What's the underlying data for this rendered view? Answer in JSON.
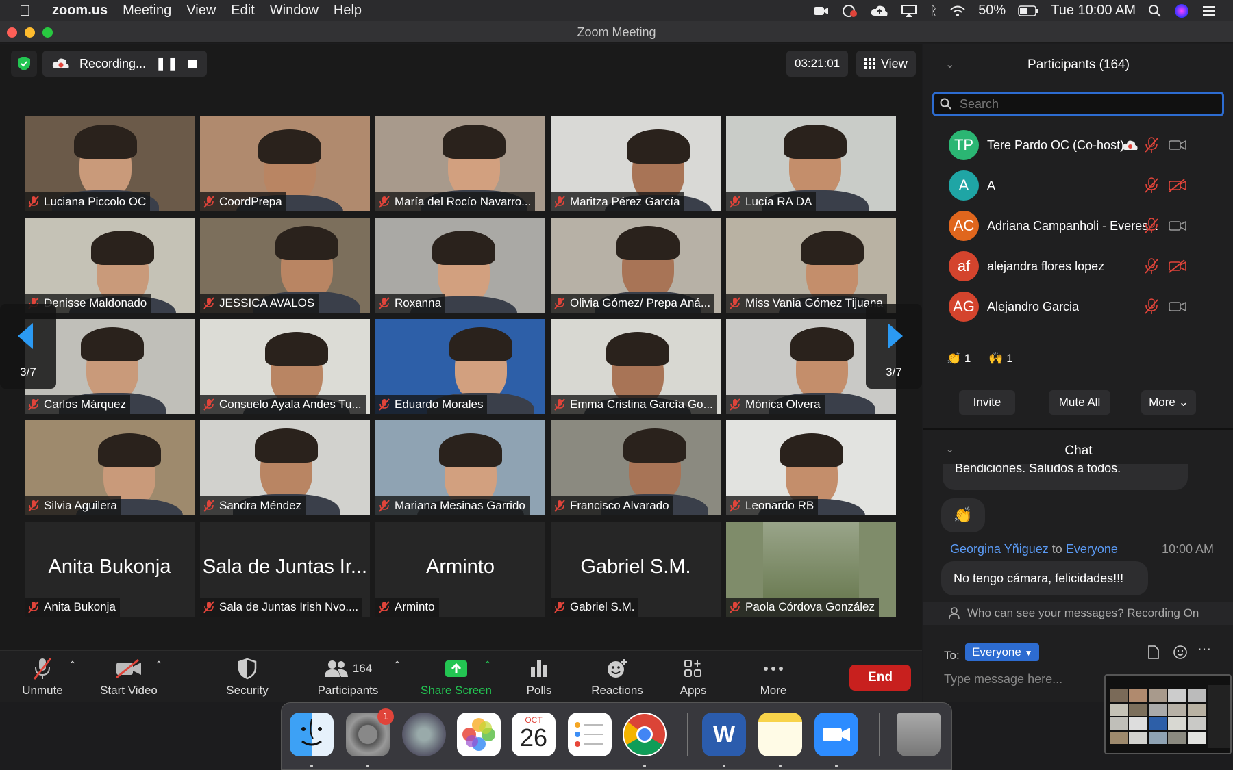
{
  "menubar": {
    "app_name": "zoom.us",
    "menus": [
      "Meeting",
      "View",
      "Edit",
      "Window",
      "Help"
    ],
    "battery": "50%",
    "clock": "Tue 10:00 AM"
  },
  "window": {
    "title": "Zoom Meeting"
  },
  "meeting": {
    "recording_label": "Recording...",
    "timer": "03:21:01",
    "view_label": "View",
    "page_indicator": "3/7"
  },
  "gallery": [
    {
      "name": "Luciana Piccolo  OC",
      "bg": "#6b5a49"
    },
    {
      "name": "CoordPrepa",
      "bg": "#b08a6e"
    },
    {
      "name": "María del Rocío Navarro...",
      "bg": "#a89a8c"
    },
    {
      "name": "Maritza Pérez García",
      "bg": "#d9d9d6"
    },
    {
      "name": "Lucía RA DA",
      "bg": "#c9ccc8"
    },
    {
      "name": "Denisse Maldonado",
      "bg": "#c5c2b6"
    },
    {
      "name": "JESSICA AVALOS",
      "bg": "#7c6f5c"
    },
    {
      "name": "Roxanna",
      "bg": "#aaa9a5"
    },
    {
      "name": "Olivia Gómez/ Prepa Aná...",
      "bg": "#b7b1a6"
    },
    {
      "name": "Miss Vania Gómez Tijuana",
      "bg": "#b9b2a3"
    },
    {
      "name": "Carlos Márquez",
      "bg": "#c0bfb9"
    },
    {
      "name": "Consuelo Ayala Andes Tu...",
      "bg": "#dcdcd6"
    },
    {
      "name": "Eduardo Morales",
      "bg": "#2d5fa8"
    },
    {
      "name": "Emma Cristina García Go...",
      "bg": "#d8d8d2"
    },
    {
      "name": "Mónica Olvera",
      "bg": "#c9c9c6"
    },
    {
      "name": "Silvia Aguilera",
      "bg": "#9e8a6d"
    },
    {
      "name": "Sandra Méndez",
      "bg": "#d2d2ce"
    },
    {
      "name": "Mariana Mesinas Garrido",
      "bg": "#8fa3b3"
    },
    {
      "name": "Francisco Alvarado",
      "bg": "#8b8a80"
    },
    {
      "name": "Leonardo RB",
      "bg": "#e2e3e0"
    },
    {
      "name": "Anita Bukonja",
      "display": "Anita Bukonja",
      "blank": true
    },
    {
      "name": "Sala de Juntas Irish Nvo....",
      "display": "Sala de Juntas Ir...",
      "blank": true
    },
    {
      "name": "Arminto",
      "display": "Arminto",
      "blank": true
    },
    {
      "name": "Gabriel S.M.",
      "display": "Gabriel S.M.",
      "blank": true
    },
    {
      "name": "Paola Córdova González",
      "bg": "#7f8c6a",
      "photo": true
    }
  ],
  "toolbar": {
    "unmute": "Unmute",
    "start_video": "Start Video",
    "security": "Security",
    "participants": "Participants",
    "participant_count": "164",
    "share_screen": "Share Screen",
    "polls": "Polls",
    "reactions": "Reactions",
    "apps": "Apps",
    "more": "More",
    "end": "End"
  },
  "participants_panel": {
    "title": "Participants (164)",
    "search_placeholder": "Search",
    "list": [
      {
        "initials": "TP",
        "name": "Tere Pardo  OC (Co-host)",
        "color": "#2bb673",
        "video_off": false,
        "recording": true
      },
      {
        "initials": "A",
        "name": "A",
        "color": "#1fa5a5",
        "video_off": true,
        "recording": false
      },
      {
        "initials": "AC",
        "name": "Adriana Campanholi - Everes...",
        "color": "#e0661d",
        "video_off": false,
        "recording": false
      },
      {
        "initials": "af",
        "name": "alejandra flores lopez",
        "color": "#d4442d",
        "video_off": true,
        "recording": false
      },
      {
        "initials": "AG",
        "name": "Alejandro Garcia",
        "color": "#d4442d",
        "video_off": false,
        "recording": false
      }
    ],
    "reactions": [
      {
        "emoji": "👏",
        "count": "1"
      },
      {
        "emoji": "🙌",
        "count": "1"
      }
    ],
    "buttons": {
      "invite": "Invite",
      "mute_all": "Mute All",
      "more": "More"
    }
  },
  "chat": {
    "title": "Chat",
    "previous_message": "Bendiciones. Saludos a todos.",
    "emoji_message": "👏",
    "sender": "Georgina Yñiguez",
    "to_word": "to",
    "recipient": "Everyone",
    "time": "10:00 AM",
    "message": "No tengo cámara, felicidades!!!",
    "notice": "Who can see your messages? Recording On",
    "to_label": "To:",
    "to_value": "Everyone",
    "input_placeholder": "Type message here..."
  },
  "dock": {
    "calendar_month": "OCT",
    "calendar_day": "26",
    "badge": "1",
    "apps": [
      "finder",
      "system-preferences",
      "launchpad",
      "photos",
      "calendar",
      "reminders",
      "chrome",
      "word",
      "notes",
      "zoom",
      "trash"
    ]
  },
  "colors": {
    "accent_blue": "#2d6cd1",
    "end_red": "#c8201e",
    "share_green": "#23c552",
    "mute_red": "#e0443a"
  }
}
